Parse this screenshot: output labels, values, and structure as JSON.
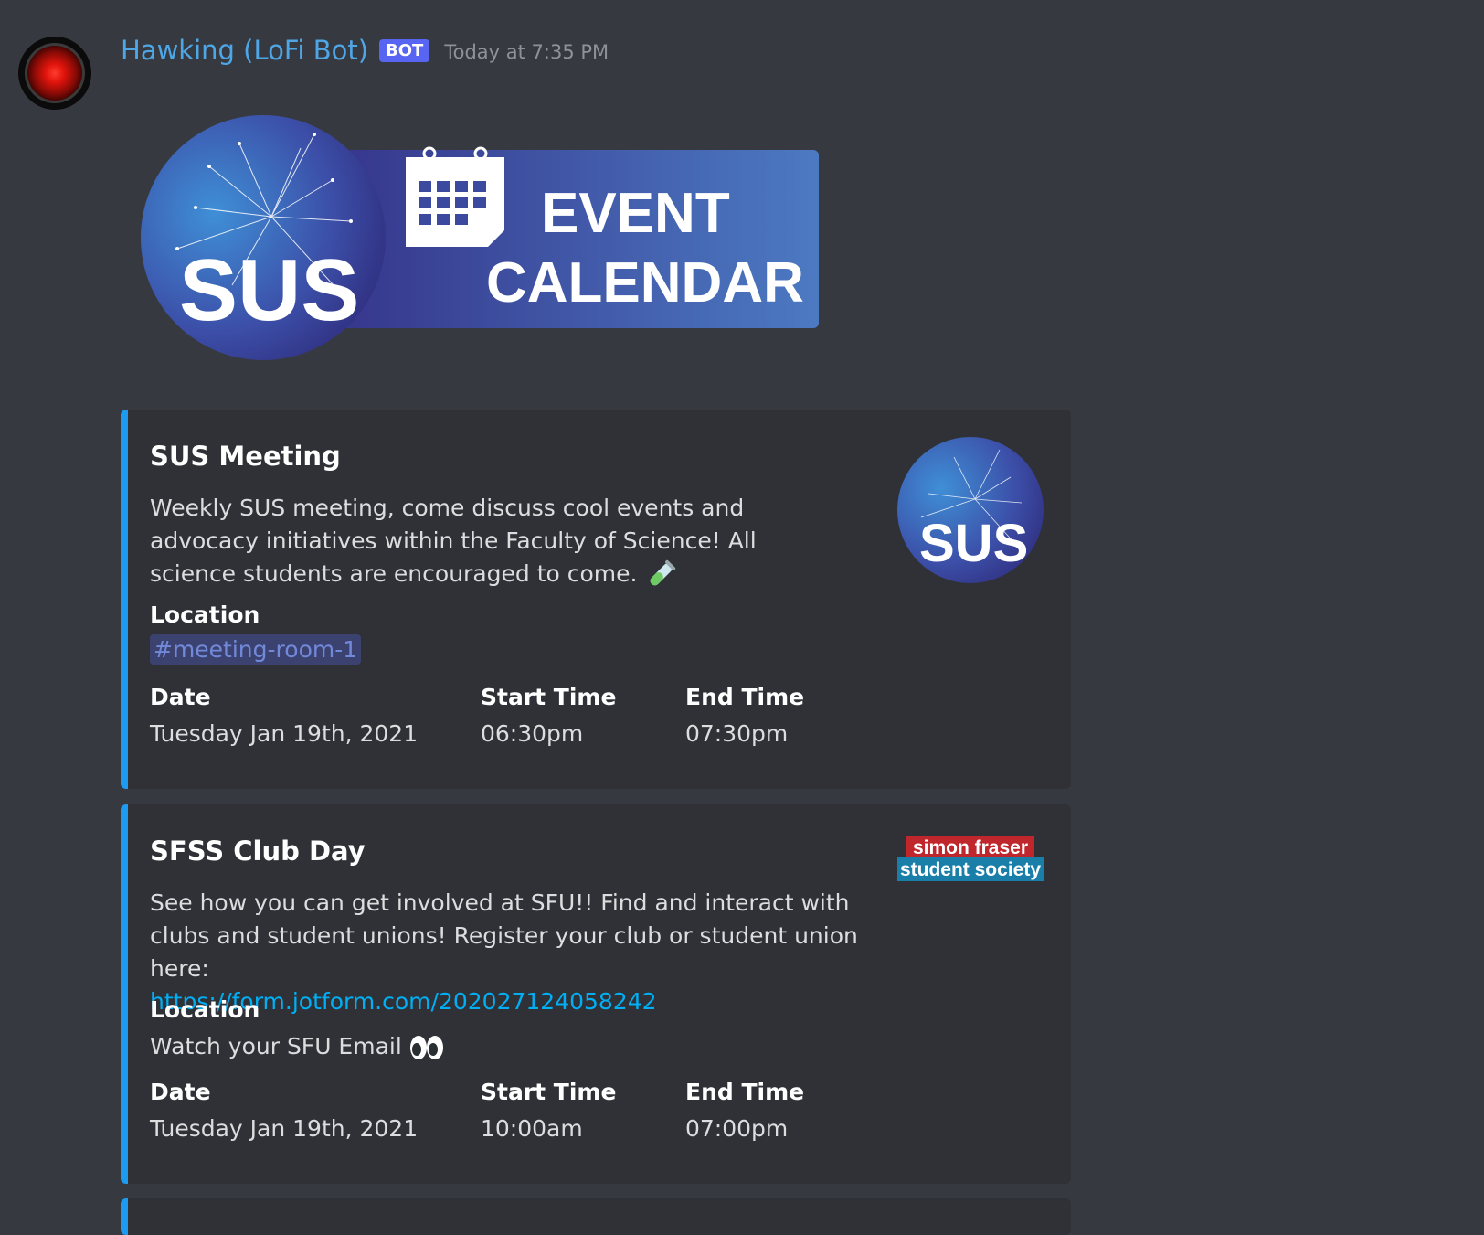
{
  "message": {
    "username": "Hawking (LoFi Bot)",
    "bot_tag": "BOT",
    "timestamp": "Today at 7:35 PM",
    "avatar_icon": "hal-9000-eye-icon"
  },
  "banner": {
    "sus_text": "SUS",
    "line1": "EVENT",
    "line2": "CALENDAR",
    "icon": "calendar-icon"
  },
  "embeds": [
    {
      "title": "SUS Meeting",
      "description": "Weekly SUS meeting, come discuss cool events and advocacy initiatives within the Faculty of Science! All science students are encouraged to come.",
      "description_emoji": "test-tube-icon",
      "location_label": "Location",
      "location_value": "#meeting-room-1",
      "date_label": "Date",
      "date_value": "Tuesday Jan 19th, 2021",
      "start_label": "Start Time",
      "start_value": "06:30pm",
      "end_label": "End Time",
      "end_value": "07:30pm",
      "thumbnail_text": "SUS",
      "accent": "#1d9bf0"
    },
    {
      "title": "SFSS Club Day",
      "description": "See how you can get involved at SFU!! Find and interact with clubs and student unions! Register your club or student union here:",
      "link": "https://form.jotform.com/202027124058242",
      "location_label": "Location",
      "location_value": "Watch your SFU Email",
      "location_emoji": "eyes-icon",
      "date_label": "Date",
      "date_value": "Tuesday Jan 19th, 2021",
      "start_label": "Start Time",
      "start_value": "10:00am",
      "end_label": "End Time",
      "end_value": "07:00pm",
      "logo_line1": "simon fraser",
      "logo_line2": "student society",
      "accent": "#1d9bf0"
    }
  ],
  "colors": {
    "background": "#36393f",
    "embed_bg": "#2f3136",
    "username": "#4fa6e6",
    "link": "#00aff4",
    "mention_bg": "#3c4270",
    "mention_text": "#7289da"
  }
}
